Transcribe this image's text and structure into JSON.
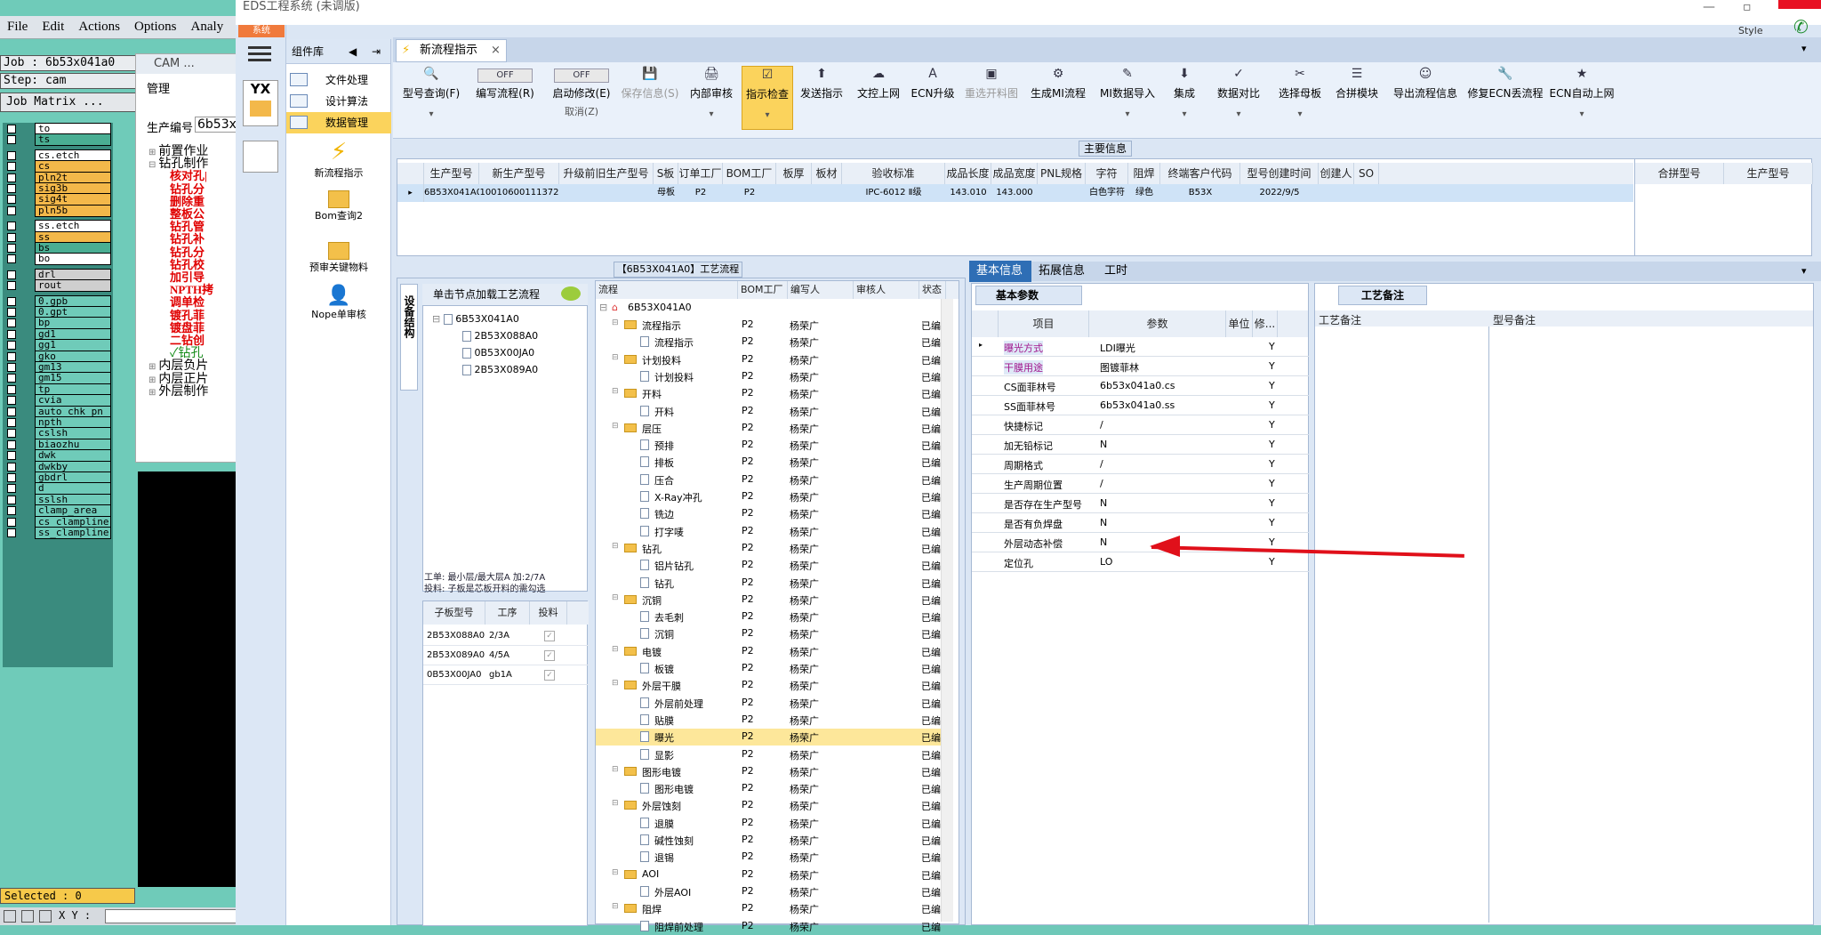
{
  "cam": {
    "menu": [
      "File",
      "Edit",
      "Actions",
      "Options",
      "Analy"
    ],
    "job": "Job : 6b53x041a0",
    "step": "Step: cam",
    "matrix_btn": "Job Matrix ...",
    "layers": [
      {
        "name": "to",
        "color": "#ffffff"
      },
      {
        "name": "ts",
        "color": "#4aae93"
      },
      {
        "name": "cs.etch",
        "color": "#ffffff"
      },
      {
        "name": "cs",
        "color": "#f3b84a"
      },
      {
        "name": "pln2t",
        "color": "#f3b84a"
      },
      {
        "name": "sig3b",
        "color": "#f3b84a"
      },
      {
        "name": "sig4t",
        "color": "#f3b84a"
      },
      {
        "name": "pln5b",
        "color": "#f3b84a"
      },
      {
        "name": "ss.etch",
        "color": "#ffffff"
      },
      {
        "name": "ss",
        "color": "#f3b84a"
      },
      {
        "name": "bs",
        "color": "#4aae93"
      },
      {
        "name": "bo",
        "color": "#ffffff"
      },
      {
        "name": "drl",
        "color": "#cfcfcf"
      },
      {
        "name": "rout",
        "color": "#cfcfcf"
      },
      {
        "name": "0.gpb",
        "color": "#6fcbb9"
      },
      {
        "name": "0.gpt",
        "color": "#6fcbb9"
      },
      {
        "name": "bp",
        "color": "#6fcbb9"
      },
      {
        "name": "gd1",
        "color": "#6fcbb9"
      },
      {
        "name": "gg1",
        "color": "#6fcbb9"
      },
      {
        "name": "gko",
        "color": "#6fcbb9"
      },
      {
        "name": "gm13",
        "color": "#6fcbb9"
      },
      {
        "name": "gm15",
        "color": "#6fcbb9"
      },
      {
        "name": "tp",
        "color": "#6fcbb9"
      },
      {
        "name": "cvia",
        "color": "#6fcbb9"
      },
      {
        "name": "auto_chk_pn",
        "color": "#6fcbb9"
      },
      {
        "name": "npth",
        "color": "#6fcbb9"
      },
      {
        "name": "cslsh",
        "color": "#6fcbb9"
      },
      {
        "name": "biaozhu",
        "color": "#6fcbb9"
      },
      {
        "name": "dwk",
        "color": "#6fcbb9"
      },
      {
        "name": "dwkby",
        "color": "#6fcbb9"
      },
      {
        "name": "gbdrl",
        "color": "#6fcbb9"
      },
      {
        "name": "d",
        "color": "#6fcbb9"
      },
      {
        "name": "sslsh",
        "color": "#6fcbb9"
      },
      {
        "name": "clamp_area",
        "color": "#6fcbb9"
      },
      {
        "name": "cs_clampline",
        "color": "#6fcbb9"
      },
      {
        "name": "ss_clampline",
        "color": "#6fcbb9"
      }
    ],
    "selected": "Selected : 0",
    "xy": "X Y :"
  },
  "camwin": {
    "title": "CAM ...",
    "mgmt": "管理",
    "prod_label": "生产编号",
    "prod_value": "6b53x",
    "tree": [
      {
        "t": "前置作业",
        "red": false,
        "ind": 0,
        "sign": "⊞"
      },
      {
        "t": "钻孔制作",
        "red": false,
        "ind": 0,
        "sign": "⊟"
      },
      {
        "t": "核对孔|",
        "red": true,
        "ind": 1,
        "sign": ""
      },
      {
        "t": "钻孔分",
        "red": true,
        "ind": 1,
        "sign": ""
      },
      {
        "t": "删除重",
        "red": true,
        "ind": 1,
        "sign": ""
      },
      {
        "t": "整板公",
        "red": true,
        "ind": 1,
        "sign": ""
      },
      {
        "t": "钻孔管",
        "red": true,
        "ind": 1,
        "sign": ""
      },
      {
        "t": "钻孔补",
        "red": true,
        "ind": 1,
        "sign": ""
      },
      {
        "t": "钻孔分",
        "red": true,
        "ind": 1,
        "sign": ""
      },
      {
        "t": "钻孔校",
        "red": true,
        "ind": 1,
        "sign": ""
      },
      {
        "t": "加引导",
        "red": true,
        "ind": 1,
        "sign": ""
      },
      {
        "t": "NPTH拷",
        "red": true,
        "ind": 1,
        "sign": ""
      },
      {
        "t": "调单检",
        "red": true,
        "ind": 1,
        "sign": ""
      },
      {
        "t": "镀孔菲",
        "red": true,
        "ind": 1,
        "sign": ""
      },
      {
        "t": "镀盘菲",
        "red": true,
        "ind": 1,
        "sign": ""
      },
      {
        "t": "二钻创",
        "red": true,
        "ind": 1,
        "sign": ""
      },
      {
        "t": "✓钻孔",
        "red": false,
        "ind": 1,
        "sign": ""
      },
      {
        "t": "内层负片",
        "red": false,
        "ind": 0,
        "sign": "⊞"
      },
      {
        "t": "内层正片",
        "red": false,
        "ind": 0,
        "sign": "⊞"
      },
      {
        "t": "外层制作",
        "red": false,
        "ind": 0,
        "sign": "⊞"
      }
    ]
  },
  "win": {
    "title": "EDS工程系统 (未调版)",
    "sys": "系统",
    "style": "Style",
    "lib_label": "组件库",
    "nav": [
      "文件处理",
      "设计算法",
      "数据管理"
    ],
    "big": [
      "新流程指示",
      "Bom查询2",
      "预审关键物料",
      "Nope单审核"
    ],
    "tab": "新流程指示"
  },
  "ribbon": [
    {
      "label": "型号查询(F)",
      "icon": "🔍",
      "sub": "▾"
    },
    {
      "label": "编写流程(R)",
      "icon": "OFF",
      "sub": ""
    },
    {
      "label": "启动修改(E)",
      "icon": "OFF",
      "sub": "取消(Z)"
    },
    {
      "label": "保存信息(S)",
      "icon": "💾",
      "sub": ""
    },
    {
      "label": "内部审核",
      "icon": "🖨",
      "sub": "▾"
    },
    {
      "label": "指示检查",
      "icon": "☑",
      "sub": "▾"
    },
    {
      "label": "发送指示",
      "icon": "⬆",
      "sub": ""
    },
    {
      "label": "文控上网",
      "icon": "☁",
      "sub": ""
    },
    {
      "label": "ECN升级",
      "icon": "A",
      "sub": ""
    },
    {
      "label": "重选开料图",
      "icon": "▣",
      "sub": ""
    },
    {
      "label": "生成MI流程",
      "icon": "⚙",
      "sub": ""
    },
    {
      "label": "MI数据导入",
      "icon": "✎",
      "sub": "▾"
    },
    {
      "label": "集成",
      "icon": "⬇",
      "sub": "▾"
    },
    {
      "label": "数据对比",
      "icon": "✓",
      "sub": "▾"
    },
    {
      "label": "选择母板",
      "icon": "✂",
      "sub": "▾"
    },
    {
      "label": "合拼模块",
      "icon": "☰",
      "sub": ""
    },
    {
      "label": "导出流程信息",
      "icon": "☺",
      "sub": ""
    },
    {
      "label": "修复ECN丢流程",
      "icon": "🔧",
      "sub": ""
    },
    {
      "label": "ECN自动上网",
      "icon": "★",
      "sub": "▾"
    }
  ],
  "main_info": {
    "title": "主要信息",
    "cols": [
      "生产型号",
      "新生产型号",
      "升级前旧生产型号",
      "S板",
      "订单工厂",
      "BOM工厂",
      "板厚",
      "板材",
      "验收标准",
      "成品长度",
      "成品宽度",
      "PNL规格",
      "字符",
      "阻焊",
      "终端客户代码",
      "型号创建时间",
      "创建人",
      "SO"
    ],
    "row": [
      "6B53X041A0",
      "10010600111372",
      "",
      "母板",
      "P2",
      "P2",
      "",
      "",
      "IPC-6012 Ⅱ级",
      "143.010",
      "143.000",
      "",
      "白色字符",
      "绿色",
      "B53X",
      "2022/9/5",
      "",
      ""
    ],
    "merge_cols": [
      "合拼型号",
      "生产型号"
    ]
  },
  "process": {
    "title": "【6B53X041A0】工艺流程",
    "vtab": "设备结构",
    "node_hint": "单击节点加载工艺流程",
    "tree_root": "6B53X041A0",
    "tree_children": [
      "2B53X088A0",
      "0B53X00JA0",
      "2B53X089A0"
    ],
    "info1": "工单: 最小层/最大层A 加:2/7A",
    "info2": "投料: 子板是芯板开料的需勾选",
    "sub_cols": [
      "子板型号",
      "工序",
      "投料"
    ],
    "sub_rows": [
      [
        "2B53X088A0",
        "2/3A"
      ],
      [
        "2B53X089A0",
        "4/5A"
      ],
      [
        "0B53X00JA0",
        "gb1A"
      ]
    ],
    "flow_cols": [
      "流程",
      "BOM工厂",
      "编写人",
      "审核人",
      "状态"
    ],
    "flow_root": "6B53X041A0",
    "flows": [
      {
        "n": "流程指示",
        "f": true
      },
      {
        "n": "流程指示",
        "f": false
      },
      {
        "n": "计划投料",
        "f": true
      },
      {
        "n": "计划投料",
        "f": false
      },
      {
        "n": "开料",
        "f": true
      },
      {
        "n": "开料",
        "f": false
      },
      {
        "n": "层压",
        "f": true
      },
      {
        "n": "预排",
        "f": false
      },
      {
        "n": "排板",
        "f": false
      },
      {
        "n": "压合",
        "f": false
      },
      {
        "n": "X-Ray冲孔",
        "f": false
      },
      {
        "n": "铣边",
        "f": false
      },
      {
        "n": "打字唛",
        "f": false
      },
      {
        "n": "钻孔",
        "f": true
      },
      {
        "n": "铝片钻孔",
        "f": false
      },
      {
        "n": "钻孔",
        "f": false
      },
      {
        "n": "沉铜",
        "f": true
      },
      {
        "n": "去毛刺",
        "f": false
      },
      {
        "n": "沉铜",
        "f": false
      },
      {
        "n": "电镀",
        "f": true
      },
      {
        "n": "板镀",
        "f": false
      },
      {
        "n": "外层干膜",
        "f": true
      },
      {
        "n": "外层前处理",
        "f": false
      },
      {
        "n": "贴膜",
        "f": false
      },
      {
        "n": "曝光",
        "f": false,
        "hl": true
      },
      {
        "n": "显影",
        "f": false
      },
      {
        "n": "图形电镀",
        "f": true
      },
      {
        "n": "图形电镀",
        "f": false
      },
      {
        "n": "外层蚀刻",
        "f": true
      },
      {
        "n": "退膜",
        "f": false
      },
      {
        "n": "碱性蚀刻",
        "f": false
      },
      {
        "n": "退锡",
        "f": false
      },
      {
        "n": "AOI",
        "f": true
      },
      {
        "n": "外层AOI",
        "f": false
      },
      {
        "n": "阻焊",
        "f": true
      },
      {
        "n": "阻焊前处理",
        "f": false
      }
    ],
    "bom": "P2",
    "author": "杨荣广",
    "status": "已编写"
  },
  "detail": {
    "tabs": [
      "基本信息",
      "拓展信息",
      "工时"
    ],
    "subtab": "基本参数",
    "cols": [
      "项目",
      "参数",
      "单位",
      "修..."
    ],
    "rows": [
      {
        "item": "曝光方式",
        "val": "LDI曝光",
        "mod": "Y",
        "color": "#a0148c"
      },
      {
        "item": "干膜用途",
        "val": "图镀菲林",
        "mod": "Y",
        "color": "#a0148c"
      },
      {
        "item": "CS面菲林号",
        "val": "6b53x041a0.cs",
        "mod": "Y",
        "color": "#000000"
      },
      {
        "item": "SS面菲林号",
        "val": "6b53x041a0.ss",
        "mod": "Y",
        "color": "#000000"
      },
      {
        "item": "快捷标记",
        "val": "/",
        "mod": "Y",
        "color": "#000000"
      },
      {
        "item": "加无铅标记",
        "val": "N",
        "mod": "Y",
        "color": "#000000"
      },
      {
        "item": "周期格式",
        "val": "/",
        "mod": "Y",
        "color": "#000000"
      },
      {
        "item": "生产周期位置",
        "val": "/",
        "mod": "Y",
        "color": "#000000"
      },
      {
        "item": "是否存在生产型号",
        "val": "N",
        "mod": "Y",
        "color": "#000000"
      },
      {
        "item": "是否有负焊盘",
        "val": "N",
        "mod": "Y",
        "color": "#000000"
      },
      {
        "item": "外层动态补偿",
        "val": "N",
        "mod": "Y",
        "color": "#000000"
      },
      {
        "item": "定位孔",
        "val": "LO",
        "mod": "Y",
        "color": "#000000"
      }
    ],
    "remark_tab": "工艺备注",
    "remark_cols": [
      "工艺备注",
      "型号备注"
    ]
  }
}
